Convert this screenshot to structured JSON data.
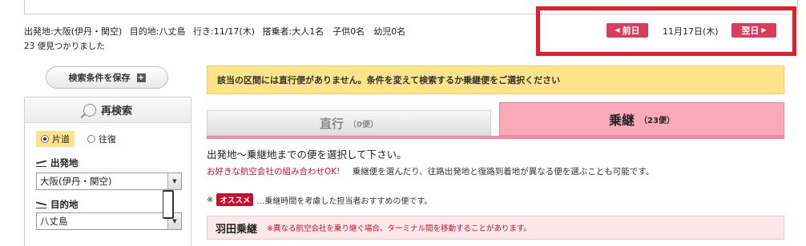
{
  "search_summary": {
    "origin": "出発地:大阪(伊丹・関空)",
    "destination": "目的地:八丈島",
    "outbound": "行き:11/17(木)",
    "passengers": "搭乗者:大人1名　子供0名　幼児0名",
    "result_count": "23 便見つかりました"
  },
  "date_nav": {
    "prev_label": "前日",
    "current_date": "11月17日(木)",
    "next_label": "翌日"
  },
  "sidebar": {
    "save_label": "検索条件を保存",
    "panel_title": "再検索",
    "trip_types": [
      "片道",
      "往復"
    ],
    "origin_label": "出発地",
    "origin_value": "大阪(伊丹・関空)",
    "destination_label": "目的地",
    "destination_value": "八丈島"
  },
  "notice_text": "該当の区間には直行便がありません。条件を変えて検索するか乗継便をご選択ください",
  "tabs": [
    {
      "label": "直行",
      "sub": "（0便）"
    },
    {
      "label": "乗継",
      "sub": "（23便）"
    }
  ],
  "instruction": "出発地～乗継地までの便を選択して下さい。",
  "hint_red": "お好きな航空会社の組み合わせOK!",
  "hint_text": "乗継便を選んだり、往路出発地と復路到着地が異なる便を選ぶことも可能です。",
  "legend": {
    "prefix": "※",
    "badge": "オススメ",
    "text": "…乗継時間を考慮した担当者おすすめの便です。"
  },
  "section": {
    "title": "羽田乗継",
    "note": "※異なる航空会社を乗り継ぐ場合、ターミナル間を移動することがあります。"
  },
  "colors": {
    "accent_red": "#db3b5c",
    "notice_yellow": "#fde48a",
    "tab_pink": "#f9a9b8",
    "highlight_frame": "#ec1a24"
  }
}
